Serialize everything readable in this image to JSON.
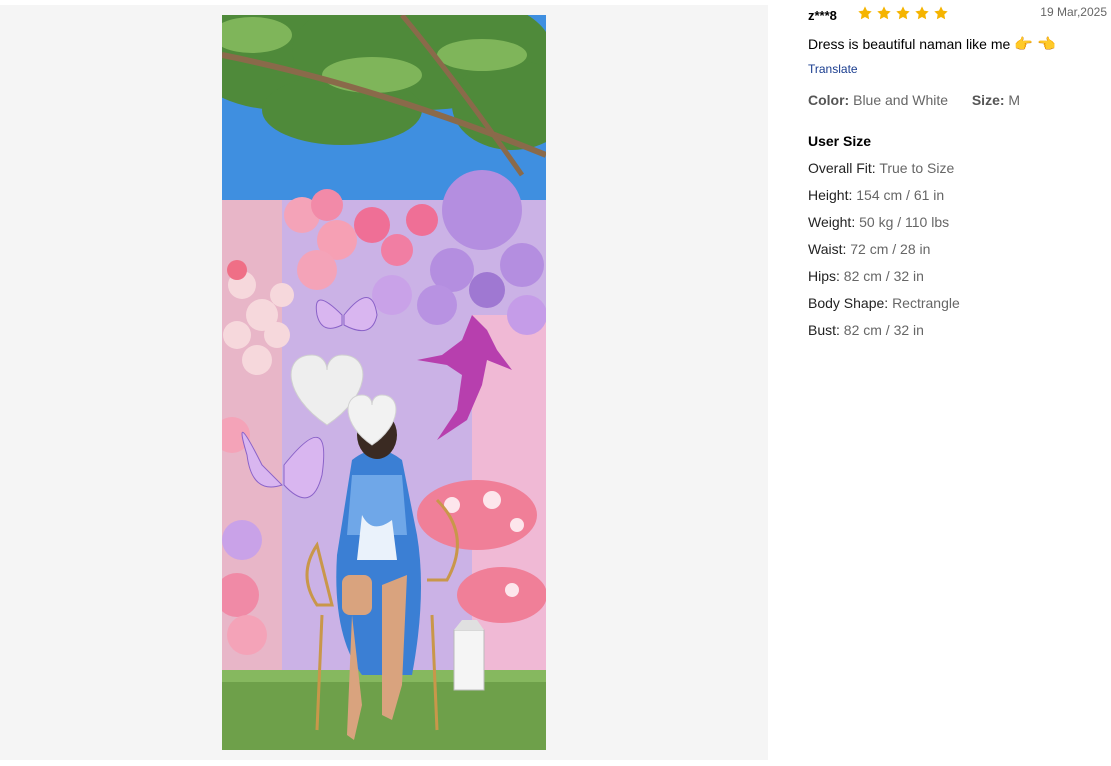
{
  "review": {
    "reviewer": "z***8",
    "rating": 5,
    "star_color": "#f5b400",
    "date": "19 Mar,2025",
    "text": "Dress is beautiful naman like me",
    "emojis": [
      "👉",
      "👈"
    ],
    "translate_label": "Translate",
    "color_label": "Color:",
    "color_value": "Blue and White",
    "size_label": "Size:",
    "size_value": "M"
  },
  "user_size": {
    "heading": "User Size",
    "rows": [
      {
        "label": "Overall Fit:",
        "value": "True to Size"
      },
      {
        "label": "Height:",
        "value": "154 cm / 61 in"
      },
      {
        "label": "Weight:",
        "value": "50 kg / 110 lbs"
      },
      {
        "label": "Waist:",
        "value": "72 cm / 28 in"
      },
      {
        "label": "Hips:",
        "value": "82 cm / 32 in"
      },
      {
        "label": "Body Shape:",
        "value": "Rectrangle"
      },
      {
        "label": "Bust:",
        "value": "82 cm / 32 in"
      }
    ]
  },
  "photo": {
    "icons": [
      "heart-icon",
      "star-icon"
    ]
  }
}
